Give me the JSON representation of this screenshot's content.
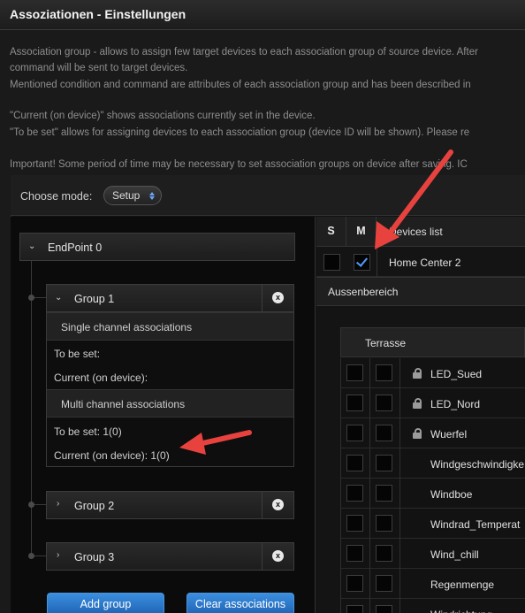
{
  "window": {
    "title": "Assoziationen - Einstellungen"
  },
  "description": {
    "lines": [
      "Association group - allows to assign few target devices to each association group of source device. After",
      "command will be sent to target devices.",
      "Mentioned condition and command are attributes of each association group and has been described in",
      "\"Current (on device)\" shows associations currently set in the device.",
      "\"To be set\" allows for assigning devices to each association group (device ID will be shown). Please re",
      "Important! Some period of time may be necessary to set association groups on device after saving. IC"
    ]
  },
  "mode": {
    "label": "Choose mode:",
    "value": "Setup"
  },
  "endpoint": {
    "label": "EndPoint 0"
  },
  "groups": [
    {
      "label": "Group 1",
      "single_channel": {
        "label": "Single channel associations",
        "to_be_set": "To be set:",
        "current": "Current (on device):"
      },
      "multi_channel": {
        "label": "Multi channel associations",
        "to_be_set": "To be set: 1(0)",
        "current": "Current (on device): 1(0)"
      }
    },
    {
      "label": "Group 2"
    },
    {
      "label": "Group 3"
    }
  ],
  "close_icon": "x",
  "buttons": {
    "add_group": "Add group",
    "clear_associations": "Clear associations"
  },
  "devices": {
    "col_s": "S",
    "col_m": "M",
    "title": "Devices list",
    "top_device": {
      "name": "Home Center 2",
      "s_checked": false,
      "m_checked": true
    },
    "room": "Aussenbereich",
    "subroom": "Terrasse",
    "items": [
      {
        "name": "LED_Sued",
        "locked": true
      },
      {
        "name": "LED_Nord",
        "locked": true
      },
      {
        "name": "Wuerfel",
        "locked": true
      },
      {
        "name": "Windgeschwindigke",
        "locked": false
      },
      {
        "name": "Windboe",
        "locked": false
      },
      {
        "name": "Windrad_Temperat",
        "locked": false
      },
      {
        "name": "Wind_chill",
        "locked": false
      },
      {
        "name": "Regenmenge",
        "locked": false
      },
      {
        "name": "Windrichtung",
        "locked": false
      }
    ]
  },
  "colors": {
    "accent": "#2f7fd4",
    "annotation_arrow": "#e8423f"
  }
}
